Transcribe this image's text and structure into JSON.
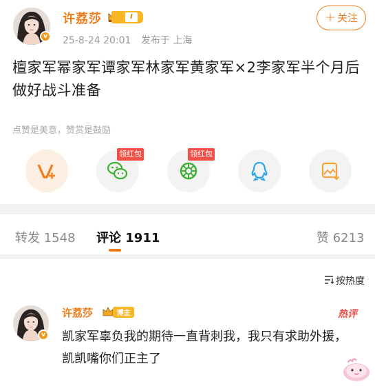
{
  "post": {
    "author_name": "许荔莎",
    "level": "I",
    "timestamp": "25-8-24 20:01",
    "location": "发布于 上海",
    "follow_label": "关注",
    "follow_plus": "+",
    "body": "檀家军幂家军谭家军林家军黄家军×2李家军半个月后做好战斗准备",
    "reward_tip": "点赞是美意，赞赏是鼓励",
    "share_actions": [
      {
        "icon": "reward-v-icon"
      },
      {
        "icon": "wechat-icon",
        "tag": "领红包"
      },
      {
        "icon": "moments-icon",
        "tag": "领红包"
      },
      {
        "icon": "qq-icon"
      },
      {
        "icon": "save-image-icon"
      }
    ]
  },
  "tabs": {
    "repost_label": "转发",
    "repost_count": "1548",
    "comment_label": "评论",
    "comment_count": "1911",
    "like_label": "赞",
    "like_count": "6213"
  },
  "comments": {
    "sort_label": "按热度",
    "items": [
      {
        "author": "许荔莎",
        "badge": "博主",
        "hot_tag": "热评",
        "text": "凯家军辜负我的期待一直背刺我，我只有求助外援，凯凯嘴你们正主了"
      }
    ]
  },
  "colors": {
    "accent": "#f07d1a",
    "red_tag": "#f24f46",
    "badge_gold": "#f8b727"
  }
}
